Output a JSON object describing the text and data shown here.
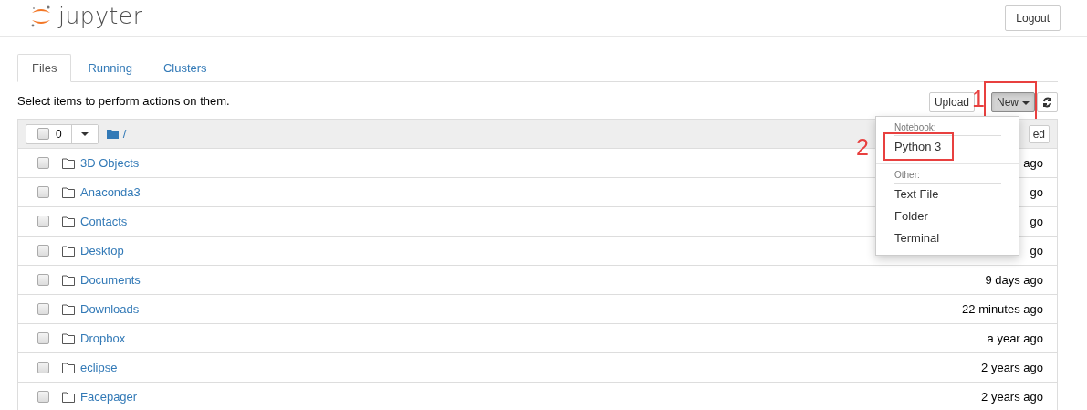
{
  "header": {
    "logo_text": "jupyter",
    "logout": "Logout"
  },
  "tabs": [
    {
      "label": "Files",
      "selected": true
    },
    {
      "label": "Running",
      "selected": false
    },
    {
      "label": "Clusters",
      "selected": false
    }
  ],
  "toolbar": {
    "hint": "Select items to perform actions on them.",
    "upload": "Upload",
    "new": "New",
    "new_open": true
  },
  "list_header": {
    "selected_count": "0",
    "all_checked": false,
    "path": "/",
    "sort_button": "ed"
  },
  "new_menu": [
    {
      "kind": "header",
      "label": "Notebook:"
    },
    {
      "kind": "item",
      "label": "Python 3"
    },
    {
      "kind": "divider"
    },
    {
      "kind": "header",
      "label": "Other:"
    },
    {
      "kind": "item",
      "label": "Text File"
    },
    {
      "kind": "item",
      "label": "Folder"
    },
    {
      "kind": "item",
      "label": "Terminal"
    }
  ],
  "rows": [
    {
      "name": "3D Objects",
      "modified": "ago",
      "checked": false
    },
    {
      "name": "Anaconda3",
      "modified": "go",
      "checked": false
    },
    {
      "name": "Contacts",
      "modified": "go",
      "checked": false
    },
    {
      "name": "Desktop",
      "modified": "go",
      "checked": false
    },
    {
      "name": "Documents",
      "modified": "9 days ago",
      "checked": false
    },
    {
      "name": "Downloads",
      "modified": "22 minutes ago",
      "checked": false
    },
    {
      "name": "Dropbox",
      "modified": "a year ago",
      "checked": false
    },
    {
      "name": "eclipse",
      "modified": "2 years ago",
      "checked": false
    },
    {
      "name": "Facepager",
      "modified": "2 years ago",
      "checked": false
    }
  ],
  "annotations": [
    {
      "number": "1"
    },
    {
      "number": "2"
    }
  ]
}
